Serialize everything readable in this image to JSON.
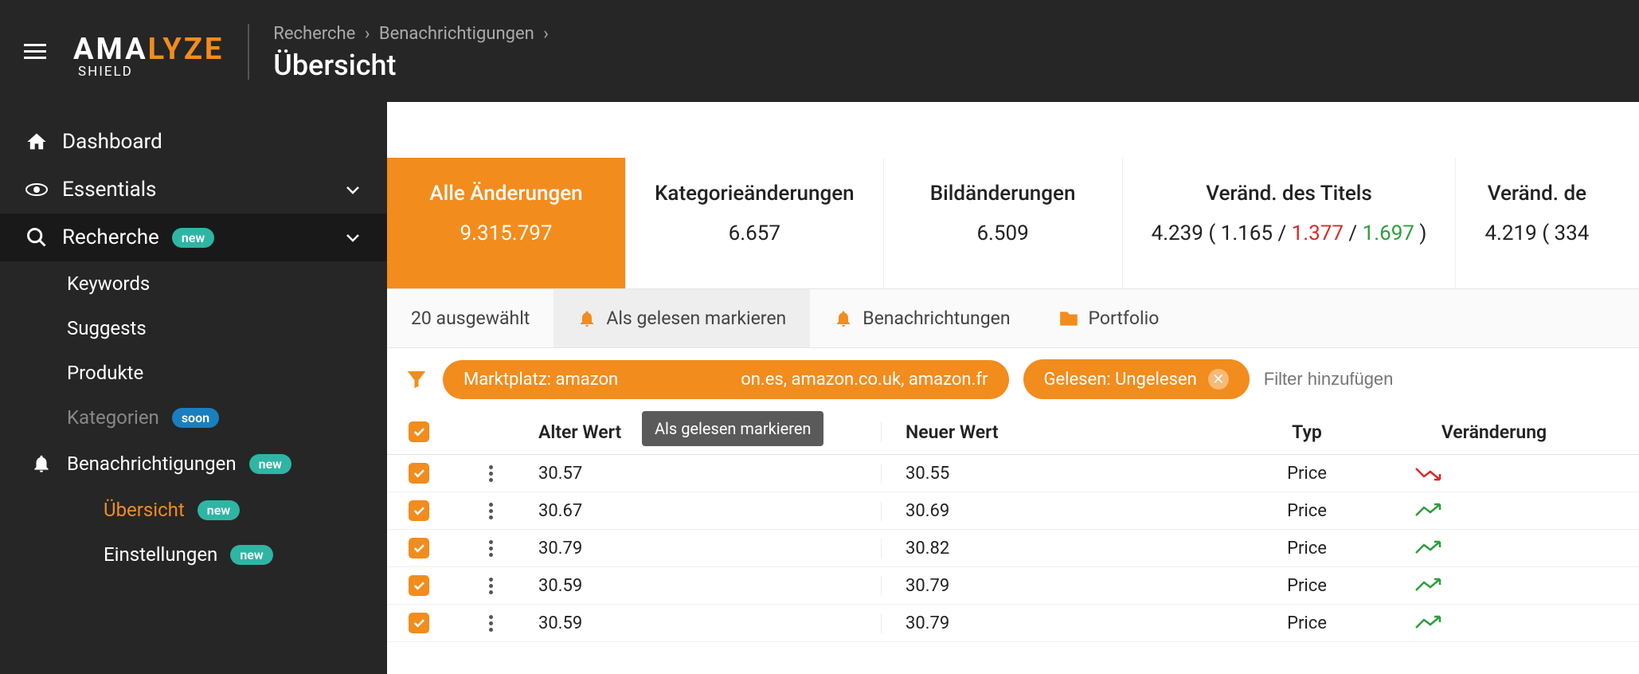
{
  "logo": {
    "part1": "AMA",
    "part2": "LYZE",
    "sub": "SHIELD"
  },
  "breadcrumb": {
    "a": "Recherche",
    "b": "Benachrichtigungen"
  },
  "page_title": "Übersicht",
  "sidebar": {
    "dashboard": "Dashboard",
    "essentials": "Essentials",
    "recherche": "Recherche",
    "keywords": "Keywords",
    "suggests": "Suggests",
    "produkte": "Produkte",
    "kategorien": "Kategorien",
    "benachrichtigungen": "Benachrichtigungen",
    "uebersicht": "Übersicht",
    "einstellungen": "Einstellungen",
    "badge_new": "new",
    "badge_soon": "soon"
  },
  "tabs": [
    {
      "title": "Alle Änderungen",
      "value": "9.315.797"
    },
    {
      "title": "Kategorieänderungen",
      "value": "6.657"
    },
    {
      "title": "Bildänderungen",
      "value": "6.509"
    },
    {
      "title": "Veränd. des Titels",
      "value_prefix": "4.239 ( ",
      "v1": "1.165",
      "v2": "1.377",
      "v3": "1.697",
      "value_suffix": " )"
    },
    {
      "title": "Veränd. de",
      "value_prefix": "4.219 ( ",
      "v1": "334"
    }
  ],
  "actions": {
    "selected": "20 ausgewählt",
    "mark_read": "Als gelesen markieren",
    "notifications": "Benachrichtungen",
    "portfolio": "Portfolio"
  },
  "tooltip": "Als gelesen markieren",
  "filters": {
    "chip1": "Marktplatz: amazon",
    "chip1_rest": "on.es, amazon.co.uk, amazon.fr",
    "chip2": "Gelesen: Ungelesen",
    "placeholder": "Filter hinzufügen"
  },
  "table": {
    "headers": {
      "old": "Alter Wert",
      "new": "Neuer Wert",
      "type": "Typ",
      "change": "Veränderung"
    },
    "rows": [
      {
        "old": "30.57",
        "new": "30.55",
        "type": "Price",
        "trend": "down"
      },
      {
        "old": "30.67",
        "new": "30.69",
        "type": "Price",
        "trend": "up"
      },
      {
        "old": "30.79",
        "new": "30.82",
        "type": "Price",
        "trend": "up"
      },
      {
        "old": "30.59",
        "new": "30.79",
        "type": "Price",
        "trend": "up"
      },
      {
        "old": "30.59",
        "new": "30.79",
        "type": "Price",
        "trend": "up"
      }
    ]
  }
}
